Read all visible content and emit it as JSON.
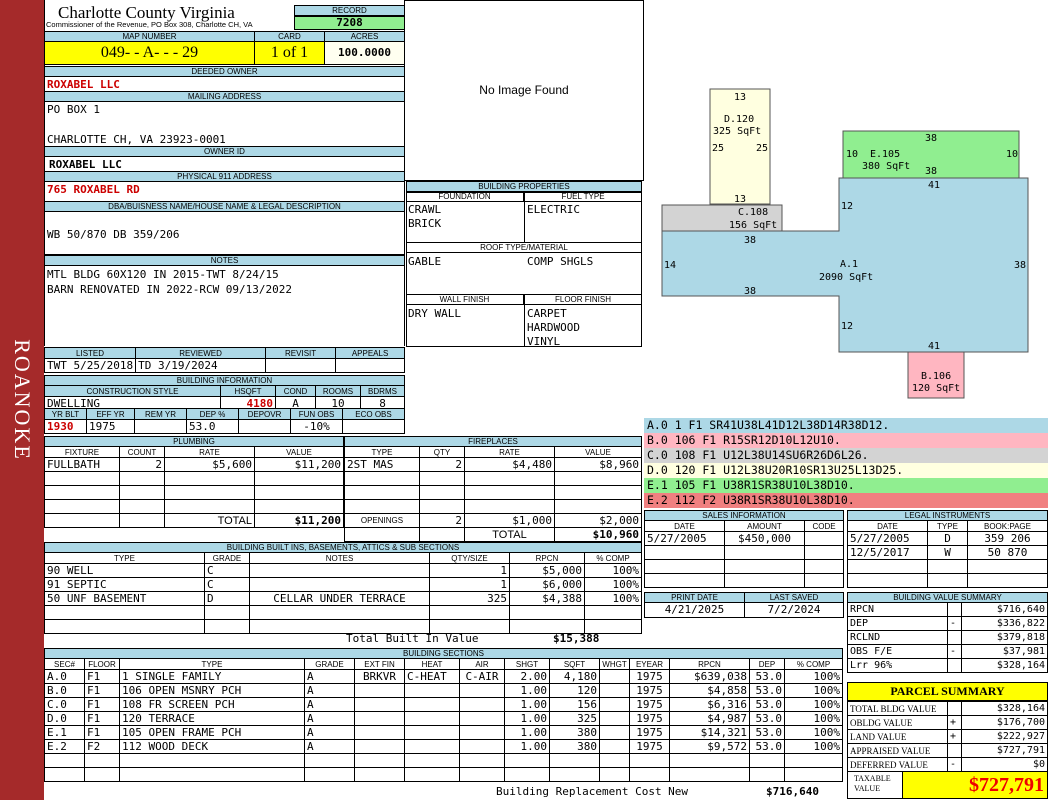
{
  "sidebar": {
    "label": "ROANOKE"
  },
  "header": {
    "county": "Charlotte County Virginia",
    "commissioner": "Commissioner of the Revenue, PO Box 308, Charlotte CH, VA",
    "record_label": "RECORD",
    "record": "7208"
  },
  "parcel": {
    "map_label": "MAP NUMBER",
    "map": "049- - A- - - 29",
    "card_label": "CARD",
    "card": "1 of 1",
    "acres_label": "ACRES",
    "acres": "100.0000"
  },
  "owner": {
    "deeded_label": "DEEDED OWNER",
    "deeded": "ROXABEL LLC",
    "mailing_label": "MAILING ADDRESS",
    "mail1": "PO BOX 1",
    "mail2": "CHARLOTTE CH, VA 23923-0001",
    "ownerid_label": "OWNER ID",
    "ownerid": "ROXABEL LLC",
    "phys_label": "PHYSICAL 911 ADDRESS",
    "phys": "765 ROXABEL RD",
    "dba_label": "DBA/BUISNESS NAME/HOUSE NAME & LEGAL DESCRIPTION",
    "dba": "WB 50/870 DB 359/206",
    "notes_label": "NOTES",
    "note1": "MTL BLDG 60X120 IN 2015-TWT 8/24/15",
    "note2": "BARN RENOVATED IN 2022-RCW 09/13/2022"
  },
  "review": {
    "listed_label": "LISTED",
    "reviewed_label": "REVIEWED",
    "revisit_label": "REVISIT",
    "appeals_label": "APPEALS",
    "listed": "TWT  5/25/2018",
    "reviewed": "TD   3/19/2024"
  },
  "building_info": {
    "label": "BUILDING INFORMATION",
    "cs_label": "CONSTRUCTION STYLE",
    "hsqft_label": "HSQFT",
    "cond_label": "COND",
    "rooms_label": "ROOMS",
    "bdrms_label": "BDRMS",
    "cs": "DWELLING",
    "hsqft": "4180",
    "cond": "A",
    "rooms": "10",
    "bdrms": "8",
    "yrblt_label": "YR BLT",
    "effyr_label": "EFF YR",
    "remyr_label": "REM YR",
    "dep_label": "DEP %",
    "depovr_label": "DEPOVR",
    "funobs_label": "FUN OBS",
    "ecoobs_label": "ECO OBS",
    "yrblt": "1930",
    "effyr": "1975",
    "remyr": "",
    "dep": "53.0",
    "depovr": "",
    "funobs": "-10%",
    "ecoobs": ""
  },
  "image_panel": {
    "text": "No Image Found"
  },
  "building_props": {
    "label": "BUILDING PROPERTIES",
    "foundation_label": "FOUNDATION",
    "fuel_label": "FUEL TYPE",
    "foundation1": "CRAWL",
    "foundation2": "BRICK",
    "fuel": "ELECTRIC",
    "roof_label": "ROOF TYPE/MATERIAL",
    "roof1": "GABLE",
    "roof2": "COMP SHGLS",
    "wall_label": "WALL FINISH",
    "floor_label": "FLOOR FINISH",
    "wall": "DRY WALL",
    "floor1": "CARPET",
    "floor2": "HARDWOOD",
    "floor3": "VINYL"
  },
  "sketch": {
    "D": {
      "name": "D.120",
      "area": "325 SqFt",
      "top": "13",
      "left": "25",
      "right": "25",
      "bottom": "13"
    },
    "E": {
      "name": "E.105",
      "area": "380 SqFt",
      "top": "38",
      "left": "10",
      "right": "10",
      "bottom": "38"
    },
    "C": {
      "name": "C.108",
      "area": "156 SqFt",
      "left": "12",
      "bottom": "38"
    },
    "A": {
      "name": "A.1",
      "area": "2090 SqFt",
      "top": "41",
      "left": "14",
      "right": "38",
      "bottom_left": "38",
      "inner": "12",
      "bottom": "41"
    },
    "B": {
      "name": "B.106",
      "area": "120 SqFt"
    }
  },
  "sketch_legend": [
    {
      "text": "A.0   1    F1   SR41U38L41D12L38D14R38D12.",
      "color": "#add8e6"
    },
    {
      "text": "B.0   106  F1   R15SR12D10L12U10.",
      "color": "#ffb6c1"
    },
    {
      "text": "C.0   108  F1   U12L38U14SU6R26D6L26.",
      "color": "#d3d3d3"
    },
    {
      "text": "D.0   120  F1   U12L38U20R10SR13U25L13D25.",
      "color": "#ffffe0"
    },
    {
      "text": "E.1   105  F1   U38R1SR38U10L38D10.",
      "color": "#90ee90"
    },
    {
      "text": "E.2   112  F2   U38R1SR38U10L38D10.",
      "color": "#f08080"
    }
  ],
  "plumbing": {
    "label": "PLUMBING",
    "headers": [
      "FIXTURE",
      "COUNT",
      "RATE",
      "VALUE"
    ],
    "rows": [
      [
        "FULLBATH",
        "2",
        "$5,600",
        "$11,200"
      ]
    ],
    "total_label": "TOTAL",
    "total": "$11,200"
  },
  "fireplaces": {
    "label": "FIREPLACES",
    "headers": [
      "TYPE",
      "QTY",
      "RATE",
      "VALUE"
    ],
    "rows": [
      [
        "2ST MAS",
        "2",
        "$4,480",
        "$8,960"
      ]
    ],
    "openings_label": "OPENINGS",
    "openings_qty": "2",
    "openings_rate": "$1,000",
    "openings_value": "$2,000",
    "total_label": "TOTAL",
    "total": "$10,960"
  },
  "sales": {
    "label": "SALES INFORMATION",
    "headers": [
      "DATE",
      "AMOUNT",
      "CODE"
    ],
    "rows": [
      [
        "5/27/2005",
        "$450,000",
        ""
      ]
    ]
  },
  "legal": {
    "label": "LEGAL INSTRUMENTS",
    "headers": [
      "DATE",
      "TYPE",
      "BOOK:PAGE"
    ],
    "rows": [
      [
        "5/27/2005",
        "D",
        "359 206"
      ],
      [
        "12/5/2017",
        "W",
        "50 870"
      ]
    ]
  },
  "dates": {
    "print_label": "PRINT DATE",
    "print": "4/21/2025",
    "saved_label": "LAST SAVED",
    "saved": "7/2/2024"
  },
  "builtins": {
    "label": "BUILDING BUILT INS, BASEMENTS, ATTICS & SUB SECTIONS",
    "headers": [
      "TYPE",
      "GRADE",
      "NOTES",
      "QTY/SIZE",
      "RPCN",
      "% COMP"
    ],
    "rows": [
      [
        "90 WELL",
        "C",
        "",
        "1",
        "$5,000",
        "100%"
      ],
      [
        "91 SEPTIC",
        "C",
        "",
        "1",
        "$6,000",
        "100%"
      ],
      [
        "50 UNF BASEMENT",
        "D",
        "CELLAR UNDER TERRACE",
        "325",
        "$4,388",
        "100%"
      ]
    ],
    "total_label": "Total Built In Value",
    "total": "$15,388"
  },
  "value_summary": {
    "label": "BUILDING VALUE SUMMARY",
    "rows": [
      [
        "RPCN",
        "",
        "$716,640"
      ],
      [
        "DEP",
        "-",
        "$336,822"
      ],
      [
        "RCLND",
        "",
        "$379,818"
      ],
      [
        "OBS F/E",
        "-",
        "$37,981"
      ],
      [
        "Lrr            96%",
        "",
        "$328,164"
      ]
    ]
  },
  "sections": {
    "label": "BUILDING SECTIONS",
    "headers": [
      "SEC#",
      "FLOOR",
      "TYPE",
      "GRADE",
      "EXT FIN",
      "HEAT",
      "AIR",
      "SHGT",
      "SQFT",
      "WHGT",
      "EYEAR",
      "RPCN",
      "DEP",
      "% COMP"
    ],
    "rows": [
      [
        "A.0",
        "F1",
        "1 SINGLE FAMILY",
        "A",
        "BRKVR",
        "C-HEAT",
        "C-AIR",
        "2.00",
        "4,180",
        "",
        "1975",
        "$639,038",
        "53.0",
        "100%"
      ],
      [
        "B.0",
        "F1",
        "106 OPEN MSNRY PCH",
        "A",
        "",
        "",
        "",
        "1.00",
        "120",
        "",
        "1975",
        "$4,858",
        "53.0",
        "100%"
      ],
      [
        "C.0",
        "F1",
        "108 FR SCREEN PCH",
        "A",
        "",
        "",
        "",
        "1.00",
        "156",
        "",
        "1975",
        "$6,316",
        "53.0",
        "100%"
      ],
      [
        "D.0",
        "F1",
        "120 TERRACE",
        "A",
        "",
        "",
        "",
        "1.00",
        "325",
        "",
        "1975",
        "$4,987",
        "53.0",
        "100%"
      ],
      [
        "E.1",
        "F1",
        "105 OPEN FRAME PCH",
        "A",
        "",
        "",
        "",
        "1.00",
        "380",
        "",
        "1975",
        "$14,321",
        "53.0",
        "100%"
      ],
      [
        "E.2",
        "F2",
        "112 WOOD DECK",
        "A",
        "",
        "",
        "",
        "1.00",
        "380",
        "",
        "1975",
        "$9,572",
        "53.0",
        "100%"
      ]
    ],
    "brcn_label": "Building Replacement Cost New",
    "brcn": "$716,640"
  },
  "parcel_summary": {
    "label": "PARCEL SUMMARY",
    "rows": [
      [
        "TOTAL BLDG VALUE",
        "",
        "$328,164"
      ],
      [
        "OBLDG VALUE",
        "+",
        "$176,700"
      ],
      [
        "LAND VALUE",
        "+",
        "$222,927"
      ],
      [
        "APPRAISED VALUE",
        "",
        "$727,791"
      ],
      [
        "DEFERRED VALUE",
        "-",
        "$0"
      ]
    ],
    "taxable_label1": "TAXABLE",
    "taxable_label2": "VALUE",
    "taxable": "$727,791"
  }
}
